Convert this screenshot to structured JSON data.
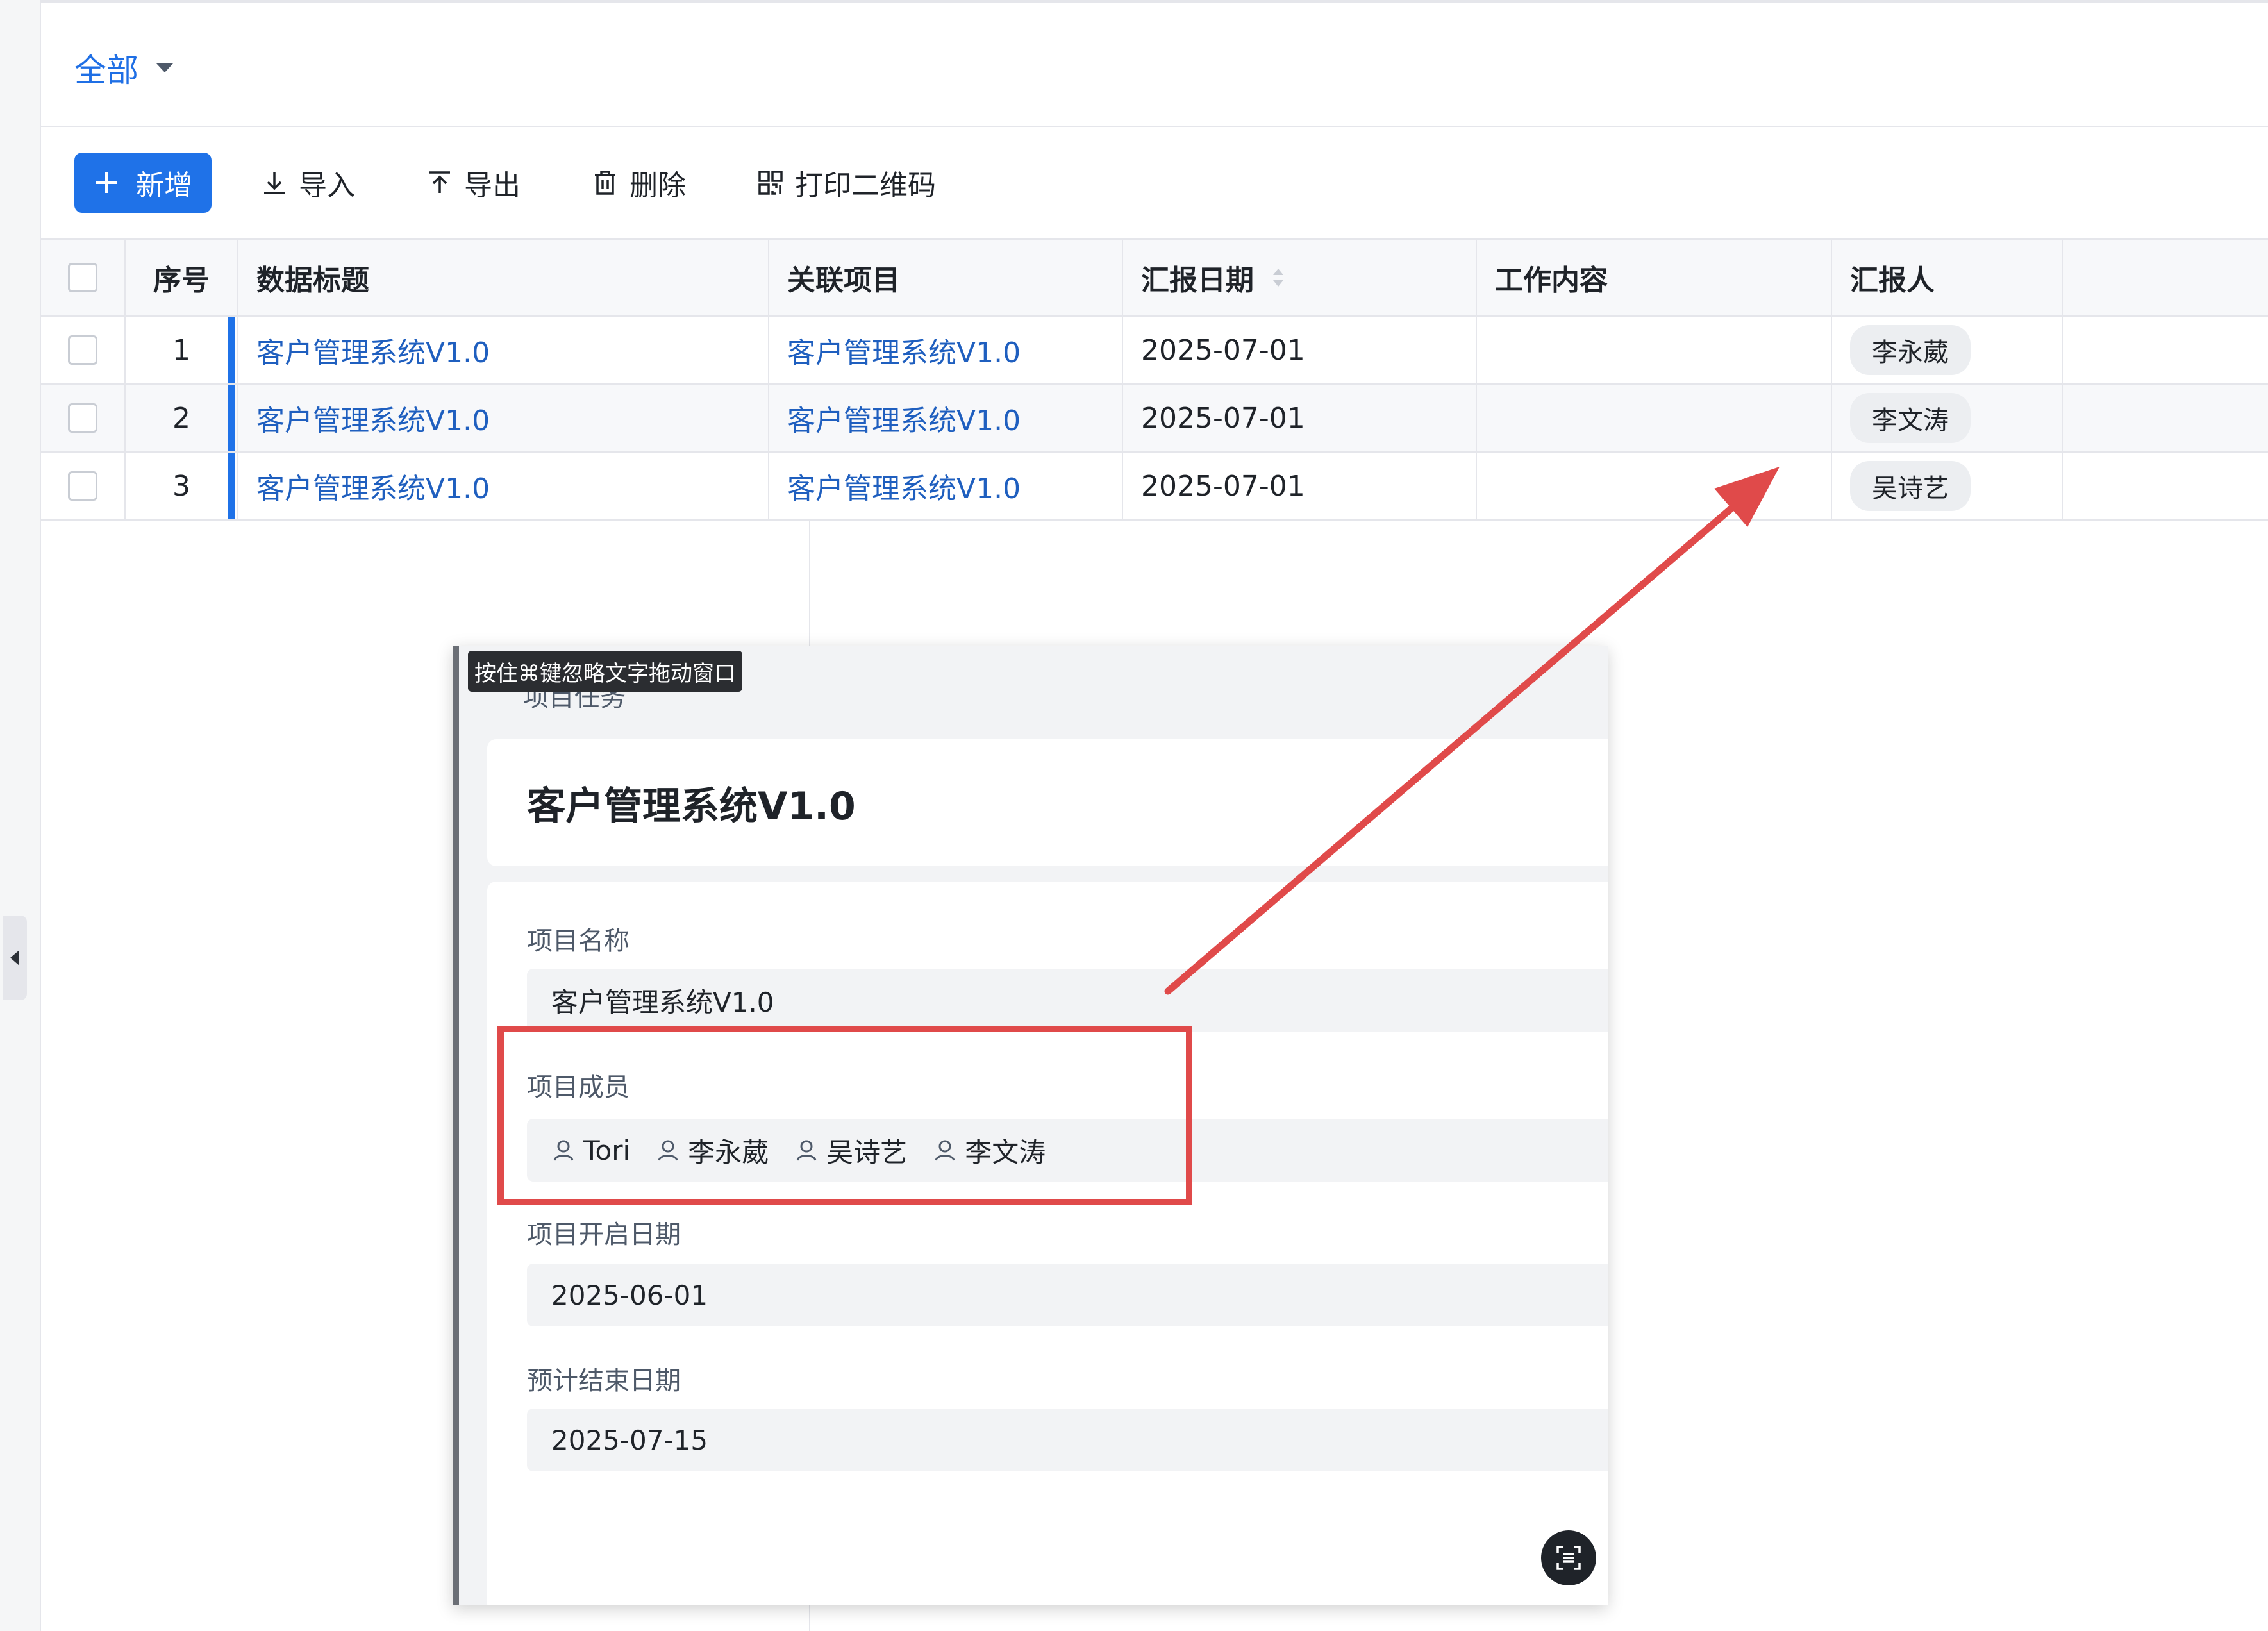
{
  "filter": {
    "label": "全部"
  },
  "toolbar": {
    "add": "新增",
    "import": "导入",
    "export": "导出",
    "delete": "删除",
    "print_qr": "打印二维码"
  },
  "table": {
    "columns": [
      "序号",
      "数据标题",
      "关联项目",
      "汇报日期",
      "工作内容",
      "汇报人"
    ],
    "rows": [
      {
        "index": "1",
        "title": "客户管理系统V1.0",
        "project": "客户管理系统V1.0",
        "date": "2025-07-01",
        "work": "",
        "reporter": "李永葳"
      },
      {
        "index": "2",
        "title": "客户管理系统V1.0",
        "project": "客户管理系统V1.0",
        "date": "2025-07-01",
        "work": "",
        "reporter": "李文涛"
      },
      {
        "index": "3",
        "title": "客户管理系统V1.0",
        "project": "客户管理系统V1.0",
        "date": "2025-07-01",
        "work": "",
        "reporter": "吴诗艺"
      }
    ]
  },
  "overlay": {
    "drag_tip": "按住⌘键忽略文字拖动窗口",
    "header": "项目任务",
    "record_title": "客户管理系统V1.0",
    "fields": {
      "name": {
        "label": "项目名称",
        "value": "客户管理系统V1.0"
      },
      "members": {
        "label": "项目成员",
        "values": [
          "Tori",
          "李永葳",
          "吴诗艺",
          "李文涛"
        ]
      },
      "start": {
        "label": "项目开启日期",
        "value": "2025-06-01"
      },
      "end": {
        "label": "预计结束日期",
        "value": "2025-07-15"
      }
    }
  },
  "colors": {
    "accent": "#1f72e8",
    "link": "#1f5fbf",
    "annotation": "#e04a4a"
  }
}
